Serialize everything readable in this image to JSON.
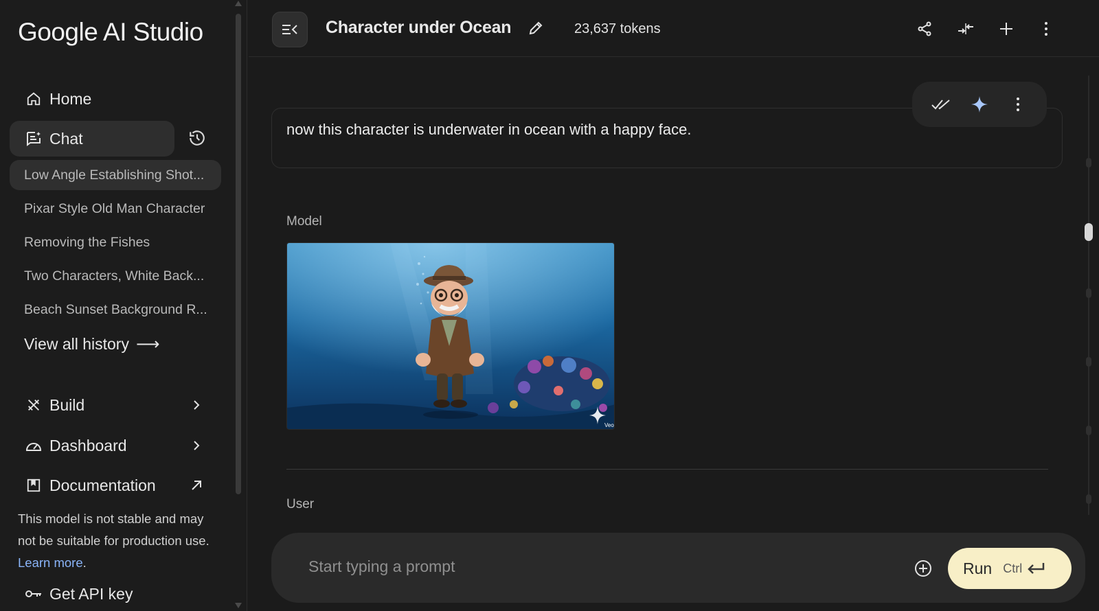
{
  "app": {
    "name": "Google AI Studio"
  },
  "sidebar": {
    "nav": {
      "home": "Home",
      "chat": "Chat",
      "build": "Build",
      "dashboard": "Dashboard",
      "documentation": "Documentation",
      "get_api_key": "Get API key"
    },
    "history": [
      "Low Angle Establishing Shot...",
      "Pixar Style Old Man Character",
      "Removing the Fishes",
      "Two Characters, White Back...",
      "Beach Sunset Background R..."
    ],
    "view_all": "View all history",
    "note": {
      "text": "This model is not stable and may not be suitable for production use.",
      "link": "Learn more",
      "period": "."
    }
  },
  "header": {
    "title": "Character under Ocean",
    "tokens": "23,637 tokens"
  },
  "conversation": {
    "user_message": "now this character is underwater in ocean with a happy face.",
    "model_label": "Model",
    "user_label": "User",
    "image_watermark": "Veo"
  },
  "composer": {
    "placeholder": "Start typing a prompt",
    "run_label": "Run",
    "run_shortcut": "Ctrl"
  },
  "colors": {
    "background": "#1b1b1b",
    "run_button": "#f8efc7",
    "link": "#8ab4f8",
    "spark": "#a8c7fa"
  }
}
